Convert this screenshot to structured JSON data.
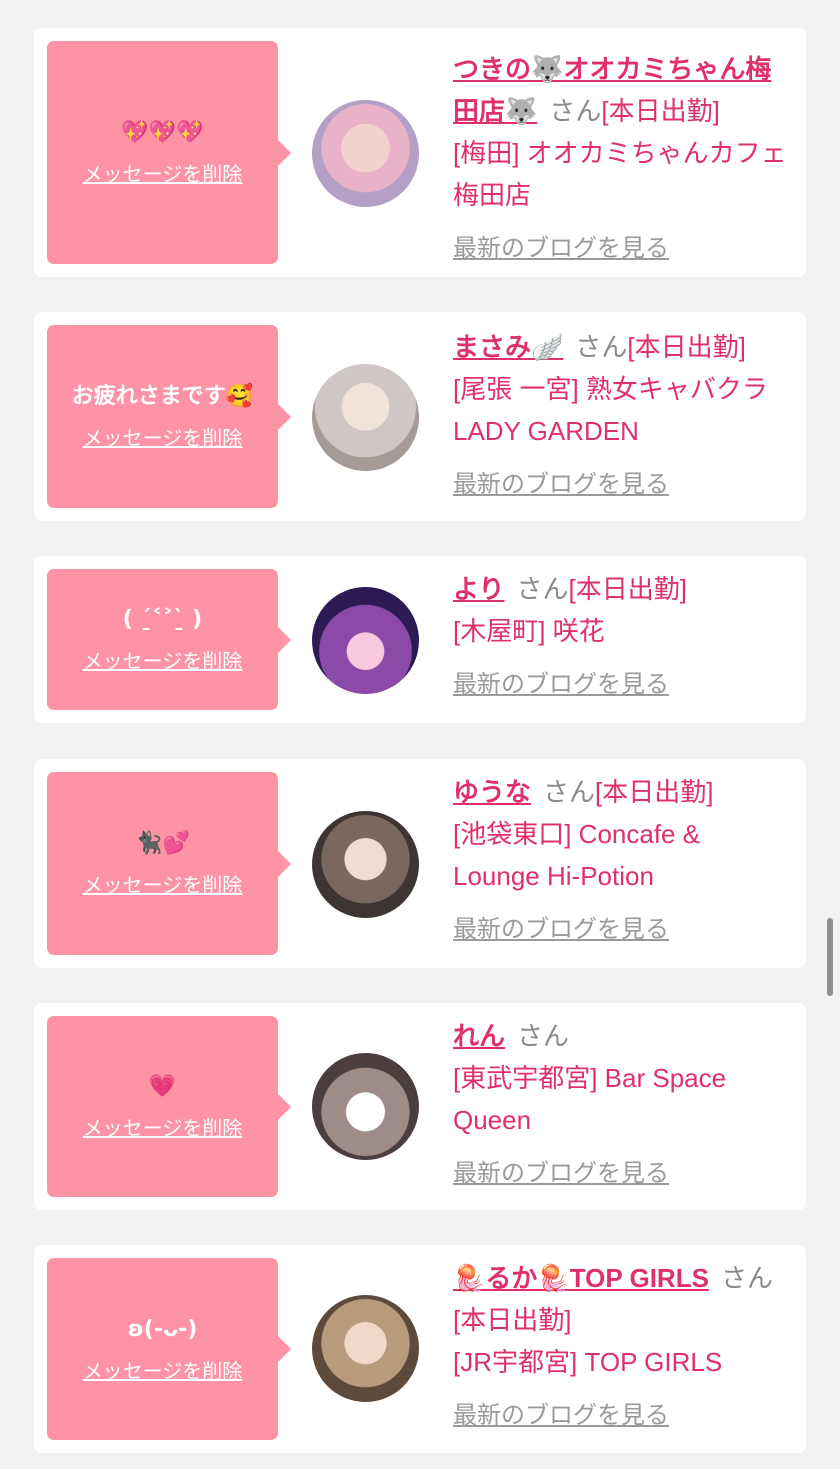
{
  "delete_label": "メッセージを削除",
  "blog_label": "最新のブログを見る",
  "san_label": "さん",
  "cards": [
    {
      "message": "💖💖💖",
      "name": "つきの🐺オオカミちゃん梅田店🐺",
      "status": "[本日出勤]",
      "shop": "[梅田] オオカミちゃんカフェ梅田店"
    },
    {
      "message": "お疲れさまです🥰",
      "name": "まさみ🪽",
      "status": "[本日出勤]",
      "shop": "[尾張 一宮] 熟女キャバクラ LADY GARDEN"
    },
    {
      "message": "( ˊ̱˂˃ˋ̱ )",
      "name": "より",
      "status": "[本日出勤]",
      "shop": "[木屋町] 咲花"
    },
    {
      "message": "🐈‍⬛💕",
      "name": "ゆうな",
      "status": "[本日出勤]",
      "shop": "[池袋東口] Concafe & Lounge Hi-Potion"
    },
    {
      "message": "💗",
      "name": "れん",
      "status": "",
      "shop": "[東武宇都宮] Bar Space Queen"
    },
    {
      "message": "ʚ(-ᴗ-)",
      "name": "🪼るか🪼TOP GIRLS",
      "status": "[本日出勤]",
      "shop": "[JR宇都宮] TOP GIRLS"
    }
  ],
  "colors": {
    "accent": "#e0306a",
    "bubble": "#fd93a4",
    "background": "#f2f2f2",
    "muted": "#9a9a9a"
  }
}
